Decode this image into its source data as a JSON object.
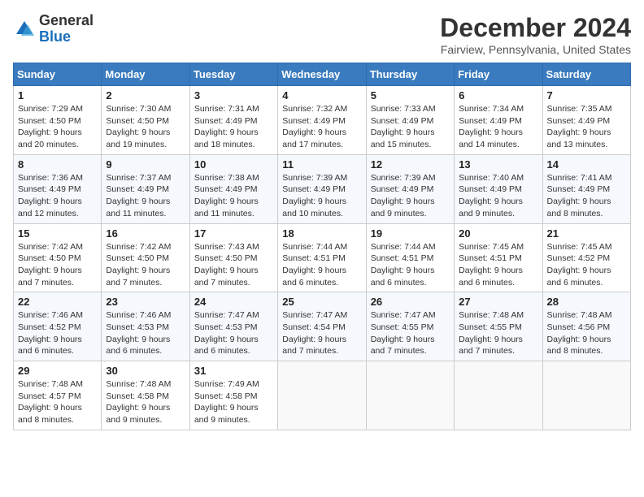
{
  "header": {
    "logo_general": "General",
    "logo_blue": "Blue",
    "month_title": "December 2024",
    "location": "Fairview, Pennsylvania, United States"
  },
  "days_of_week": [
    "Sunday",
    "Monday",
    "Tuesday",
    "Wednesday",
    "Thursday",
    "Friday",
    "Saturday"
  ],
  "weeks": [
    [
      {
        "day": 1,
        "info": "Sunrise: 7:29 AM\nSunset: 4:50 PM\nDaylight: 9 hours\nand 20 minutes."
      },
      {
        "day": 2,
        "info": "Sunrise: 7:30 AM\nSunset: 4:50 PM\nDaylight: 9 hours\nand 19 minutes."
      },
      {
        "day": 3,
        "info": "Sunrise: 7:31 AM\nSunset: 4:49 PM\nDaylight: 9 hours\nand 18 minutes."
      },
      {
        "day": 4,
        "info": "Sunrise: 7:32 AM\nSunset: 4:49 PM\nDaylight: 9 hours\nand 17 minutes."
      },
      {
        "day": 5,
        "info": "Sunrise: 7:33 AM\nSunset: 4:49 PM\nDaylight: 9 hours\nand 15 minutes."
      },
      {
        "day": 6,
        "info": "Sunrise: 7:34 AM\nSunset: 4:49 PM\nDaylight: 9 hours\nand 14 minutes."
      },
      {
        "day": 7,
        "info": "Sunrise: 7:35 AM\nSunset: 4:49 PM\nDaylight: 9 hours\nand 13 minutes."
      }
    ],
    [
      {
        "day": 8,
        "info": "Sunrise: 7:36 AM\nSunset: 4:49 PM\nDaylight: 9 hours\nand 12 minutes."
      },
      {
        "day": 9,
        "info": "Sunrise: 7:37 AM\nSunset: 4:49 PM\nDaylight: 9 hours\nand 11 minutes."
      },
      {
        "day": 10,
        "info": "Sunrise: 7:38 AM\nSunset: 4:49 PM\nDaylight: 9 hours\nand 11 minutes."
      },
      {
        "day": 11,
        "info": "Sunrise: 7:39 AM\nSunset: 4:49 PM\nDaylight: 9 hours\nand 10 minutes."
      },
      {
        "day": 12,
        "info": "Sunrise: 7:39 AM\nSunset: 4:49 PM\nDaylight: 9 hours\nand 9 minutes."
      },
      {
        "day": 13,
        "info": "Sunrise: 7:40 AM\nSunset: 4:49 PM\nDaylight: 9 hours\nand 9 minutes."
      },
      {
        "day": 14,
        "info": "Sunrise: 7:41 AM\nSunset: 4:49 PM\nDaylight: 9 hours\nand 8 minutes."
      }
    ],
    [
      {
        "day": 15,
        "info": "Sunrise: 7:42 AM\nSunset: 4:50 PM\nDaylight: 9 hours\nand 7 minutes."
      },
      {
        "day": 16,
        "info": "Sunrise: 7:42 AM\nSunset: 4:50 PM\nDaylight: 9 hours\nand 7 minutes."
      },
      {
        "day": 17,
        "info": "Sunrise: 7:43 AM\nSunset: 4:50 PM\nDaylight: 9 hours\nand 7 minutes."
      },
      {
        "day": 18,
        "info": "Sunrise: 7:44 AM\nSunset: 4:51 PM\nDaylight: 9 hours\nand 6 minutes."
      },
      {
        "day": 19,
        "info": "Sunrise: 7:44 AM\nSunset: 4:51 PM\nDaylight: 9 hours\nand 6 minutes."
      },
      {
        "day": 20,
        "info": "Sunrise: 7:45 AM\nSunset: 4:51 PM\nDaylight: 9 hours\nand 6 minutes."
      },
      {
        "day": 21,
        "info": "Sunrise: 7:45 AM\nSunset: 4:52 PM\nDaylight: 9 hours\nand 6 minutes."
      }
    ],
    [
      {
        "day": 22,
        "info": "Sunrise: 7:46 AM\nSunset: 4:52 PM\nDaylight: 9 hours\nand 6 minutes."
      },
      {
        "day": 23,
        "info": "Sunrise: 7:46 AM\nSunset: 4:53 PM\nDaylight: 9 hours\nand 6 minutes."
      },
      {
        "day": 24,
        "info": "Sunrise: 7:47 AM\nSunset: 4:53 PM\nDaylight: 9 hours\nand 6 minutes."
      },
      {
        "day": 25,
        "info": "Sunrise: 7:47 AM\nSunset: 4:54 PM\nDaylight: 9 hours\nand 7 minutes."
      },
      {
        "day": 26,
        "info": "Sunrise: 7:47 AM\nSunset: 4:55 PM\nDaylight: 9 hours\nand 7 minutes."
      },
      {
        "day": 27,
        "info": "Sunrise: 7:48 AM\nSunset: 4:55 PM\nDaylight: 9 hours\nand 7 minutes."
      },
      {
        "day": 28,
        "info": "Sunrise: 7:48 AM\nSunset: 4:56 PM\nDaylight: 9 hours\nand 8 minutes."
      }
    ],
    [
      {
        "day": 29,
        "info": "Sunrise: 7:48 AM\nSunset: 4:57 PM\nDaylight: 9 hours\nand 8 minutes."
      },
      {
        "day": 30,
        "info": "Sunrise: 7:48 AM\nSunset: 4:58 PM\nDaylight: 9 hours\nand 9 minutes."
      },
      {
        "day": 31,
        "info": "Sunrise: 7:49 AM\nSunset: 4:58 PM\nDaylight: 9 hours\nand 9 minutes."
      },
      null,
      null,
      null,
      null
    ]
  ]
}
